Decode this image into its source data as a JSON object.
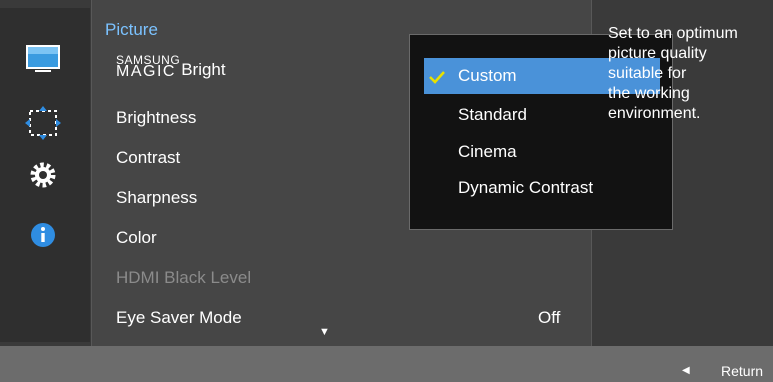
{
  "menu": {
    "title": "Picture",
    "magic_bright": {
      "brand_small": "SAMSUNG",
      "brand_big": "MAGIC",
      "suffix": "Bright"
    },
    "items": [
      {
        "label": "Brightness",
        "enabled": true
      },
      {
        "label": "Contrast",
        "enabled": true
      },
      {
        "label": "Sharpness",
        "enabled": true
      },
      {
        "label": "Color",
        "enabled": true
      },
      {
        "label": "HDMI Black Level",
        "enabled": false
      },
      {
        "label": "Eye Saver Mode",
        "enabled": true,
        "value": "Off"
      }
    ]
  },
  "submenu": {
    "selected": "Custom",
    "options": [
      "Custom",
      "Standard",
      "Cinema",
      "Dynamic Contrast"
    ]
  },
  "description": {
    "lines": [
      "Set to an optimum",
      "picture quality",
      "suitable for",
      "the working",
      "environment."
    ]
  },
  "footer": {
    "return_label": "Return"
  },
  "icons": {
    "left_rail": [
      "picture-icon",
      "position-icon",
      "gear-icon",
      "info-icon"
    ],
    "check": "check-icon",
    "scroll": "down-arrow-icon",
    "return": "left-arrow-icon"
  },
  "colors": {
    "accent": "#7bc2ff",
    "selection": "#4a92d9",
    "check": "#e8e100",
    "panel": "#464646",
    "background": "#3a3a3a",
    "footer": "#6c6c6c"
  }
}
